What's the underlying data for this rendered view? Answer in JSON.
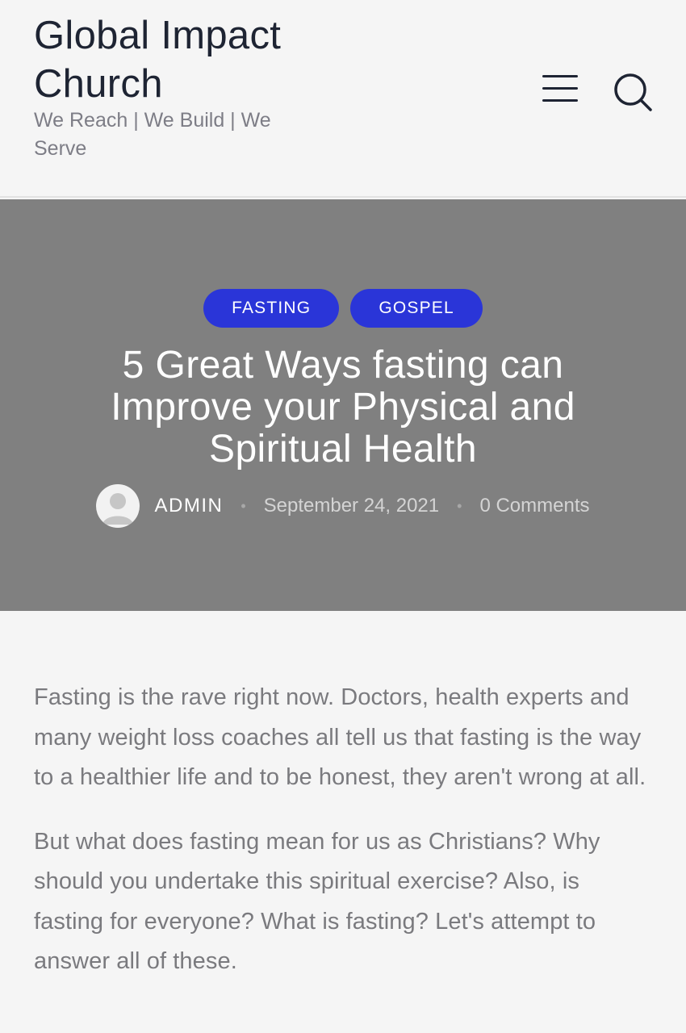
{
  "header": {
    "site_title": "Global Impact Church",
    "tagline": "We Reach | We Build | We Serve",
    "menu_icon": "hamburger-icon",
    "search_icon": "search-icon"
  },
  "hero": {
    "categories": [
      "FASTING",
      "GOSPEL"
    ],
    "title": "5 Great Ways fasting can Improve your Physical and Spiritual Health",
    "author": "ADMIN",
    "date": "September 24, 2021",
    "comments": "0 Comments",
    "separator": "•"
  },
  "content": {
    "paragraphs": [
      "Fasting is the rave right now. Doctors, health experts and many weight loss coaches all tell us that fasting is the way to a healthier life and to be honest, they aren't wrong at all.",
      "But what does fasting mean for us as Christians? Why should you undertake this spiritual exercise? Also, is fasting for everyone? What is fasting? Let's attempt to answer all of these."
    ]
  },
  "colors": {
    "background": "#f5f5f5",
    "hero_bg": "#808080",
    "category_pill": "#2a35d8",
    "title_dark": "#1e2433",
    "body_text": "#7a7a7e"
  }
}
